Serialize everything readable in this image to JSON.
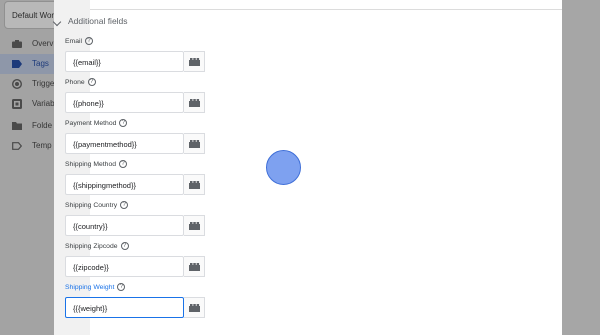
{
  "shell": {
    "workspace_button": "Default Wor",
    "nav": [
      {
        "label": "Overv",
        "icon": "briefcase-icon"
      },
      {
        "label": "Tags",
        "icon": "tag-icon"
      },
      {
        "label": "Trigge",
        "icon": "trigger-icon"
      },
      {
        "label": "Variab",
        "icon": "variables-icon"
      },
      {
        "label": "Folde",
        "icon": "folder-icon"
      },
      {
        "label": "Temp",
        "icon": "template-icon"
      }
    ]
  },
  "section": {
    "title": "Additional fields"
  },
  "fields": [
    {
      "label": "Email",
      "value": "{{email}}"
    },
    {
      "label": "Phone",
      "value": "{{phone}}"
    },
    {
      "label": "Payment Method",
      "value": "{{paymentmethod}}"
    },
    {
      "label": "Shipping Method",
      "value": "{{shippingmethod}}"
    },
    {
      "label": "Shipping Country",
      "value": "{{country}}"
    },
    {
      "label": "Shipping Zipcode",
      "value": "{{zipcode}}"
    },
    {
      "label": "Shipping Weight",
      "value": "{{{weight}}"
    }
  ],
  "help_glyph": "?",
  "colors": {
    "accent": "#1a73e8",
    "click_indicator": "#7ea1f0"
  }
}
